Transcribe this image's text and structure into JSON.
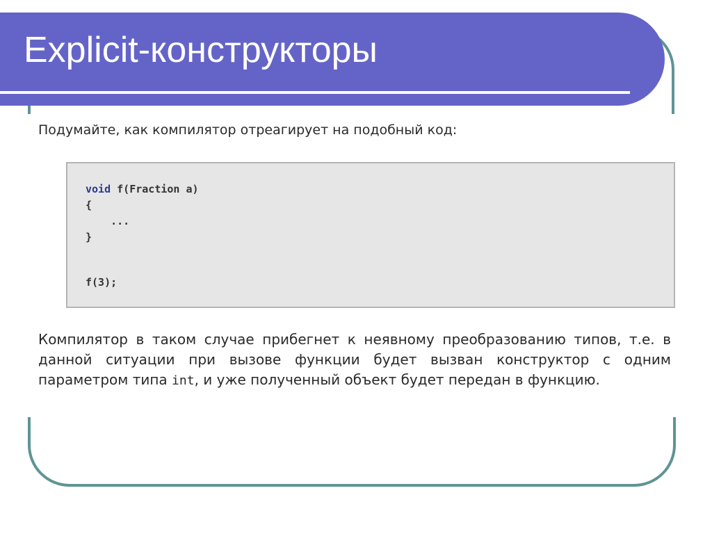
{
  "slide": {
    "title": "Explicit-конструкторы",
    "intro": "Подумайте, как компилятор отреагирует на подобный код:",
    "code": {
      "line1_keyword": "void",
      "line1_rest": " f(Fraction a)",
      "line2": "{",
      "line3": "    ...",
      "line4": "}",
      "line5": "f(3);"
    },
    "paragraph": {
      "part1": "Компилятор в таком случае прибегнет к неявному преобразованию типов, т.е. в данной ситуации при вызове функции будет вызван конструктор с одним параметром типа ",
      "code_word": "int",
      "part2": ", и уже полученный объект будет передан в функцию."
    },
    "colors": {
      "title_bar": "#6464c8",
      "frame": "#5f9494",
      "code_background": "#e6e6e6"
    }
  }
}
